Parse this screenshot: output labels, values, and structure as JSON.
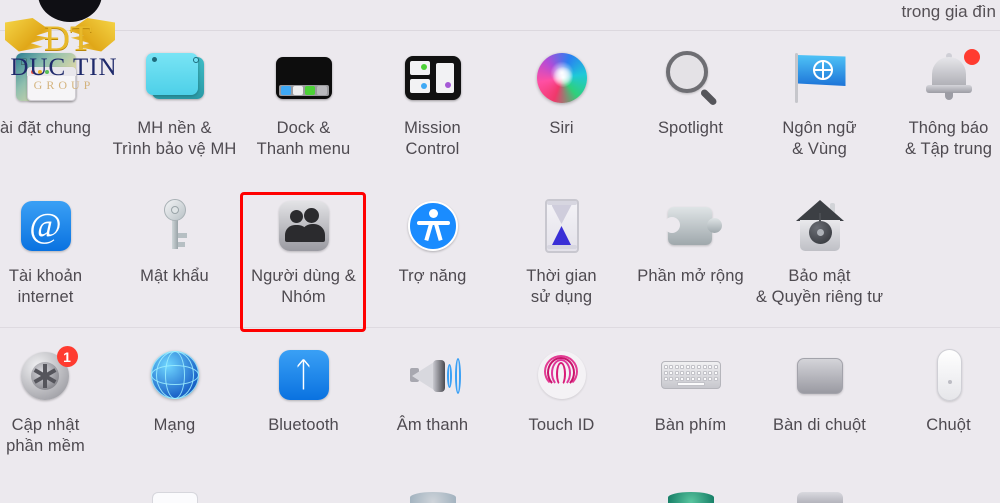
{
  "window": {
    "background_color": "#ece9ee",
    "clipped_top_text": "trong gia đìn"
  },
  "watermark": {
    "title": "DUC TIN",
    "subtitle": "GROUP",
    "monogram": "ÐT"
  },
  "highlight": {
    "color": "#ff0000",
    "target_label": "Người dùng & Nhóm"
  },
  "rows": [
    {
      "items": [
        {
          "label": "ài đặt chung",
          "icon": "general-settings-icon"
        },
        {
          "label": "MH nền &\nTrình bảo vệ MH",
          "icon": "desktop-screensaver-icon"
        },
        {
          "label": "Dock &\nThanh menu",
          "icon": "dock-menubar-icon"
        },
        {
          "label": "Mission\nControl",
          "icon": "mission-control-icon"
        },
        {
          "label": "Siri",
          "icon": "siri-icon"
        },
        {
          "label": "Spotlight",
          "icon": "spotlight-icon"
        },
        {
          "label": "Ngôn ngữ\n& Vùng",
          "icon": "language-region-icon"
        },
        {
          "label": "Thông báo\n& Tập trung",
          "icon": "notifications-focus-icon"
        }
      ]
    },
    {
      "items": [
        {
          "label": "Tài khoản\ninternet",
          "icon": "internet-accounts-icon"
        },
        {
          "label": "Mật khẩu",
          "icon": "passwords-key-icon"
        },
        {
          "label": "Người dùng &\nNhóm",
          "icon": "users-groups-icon"
        },
        {
          "label": "Trợ năng",
          "icon": "accessibility-icon"
        },
        {
          "label": "Thời gian\nsử dụng",
          "icon": "screen-time-hourglass-icon"
        },
        {
          "label": "Phần mở rộng",
          "icon": "extensions-puzzle-icon"
        },
        {
          "label": "Bảo mật\n& Quyền riêng tư",
          "icon": "security-privacy-icon"
        }
      ]
    },
    {
      "items": [
        {
          "label": "Cập nhật\nphần mềm",
          "icon": "software-update-icon",
          "badge": "1"
        },
        {
          "label": "Mạng",
          "icon": "network-globe-icon"
        },
        {
          "label": "Bluetooth",
          "icon": "bluetooth-icon"
        },
        {
          "label": "Âm thanh",
          "icon": "sound-speaker-icon"
        },
        {
          "label": "Touch ID",
          "icon": "touch-id-icon"
        },
        {
          "label": "Bàn phím",
          "icon": "keyboard-icon"
        },
        {
          "label": "Bàn di chuột",
          "icon": "trackpad-icon"
        },
        {
          "label": "Chuột",
          "icon": "mouse-icon"
        }
      ]
    },
    {
      "items": [
        {
          "label": "",
          "icon": "display-icon-partial"
        },
        {
          "label": "",
          "icon": "printers-scanners-icon-partial"
        },
        {
          "label": "",
          "icon": "startup-disk-icon-partial"
        },
        {
          "label": "",
          "icon": "time-machine-icon-partial"
        },
        {
          "label": "",
          "icon": "sharing-icon-partial"
        }
      ]
    }
  ]
}
